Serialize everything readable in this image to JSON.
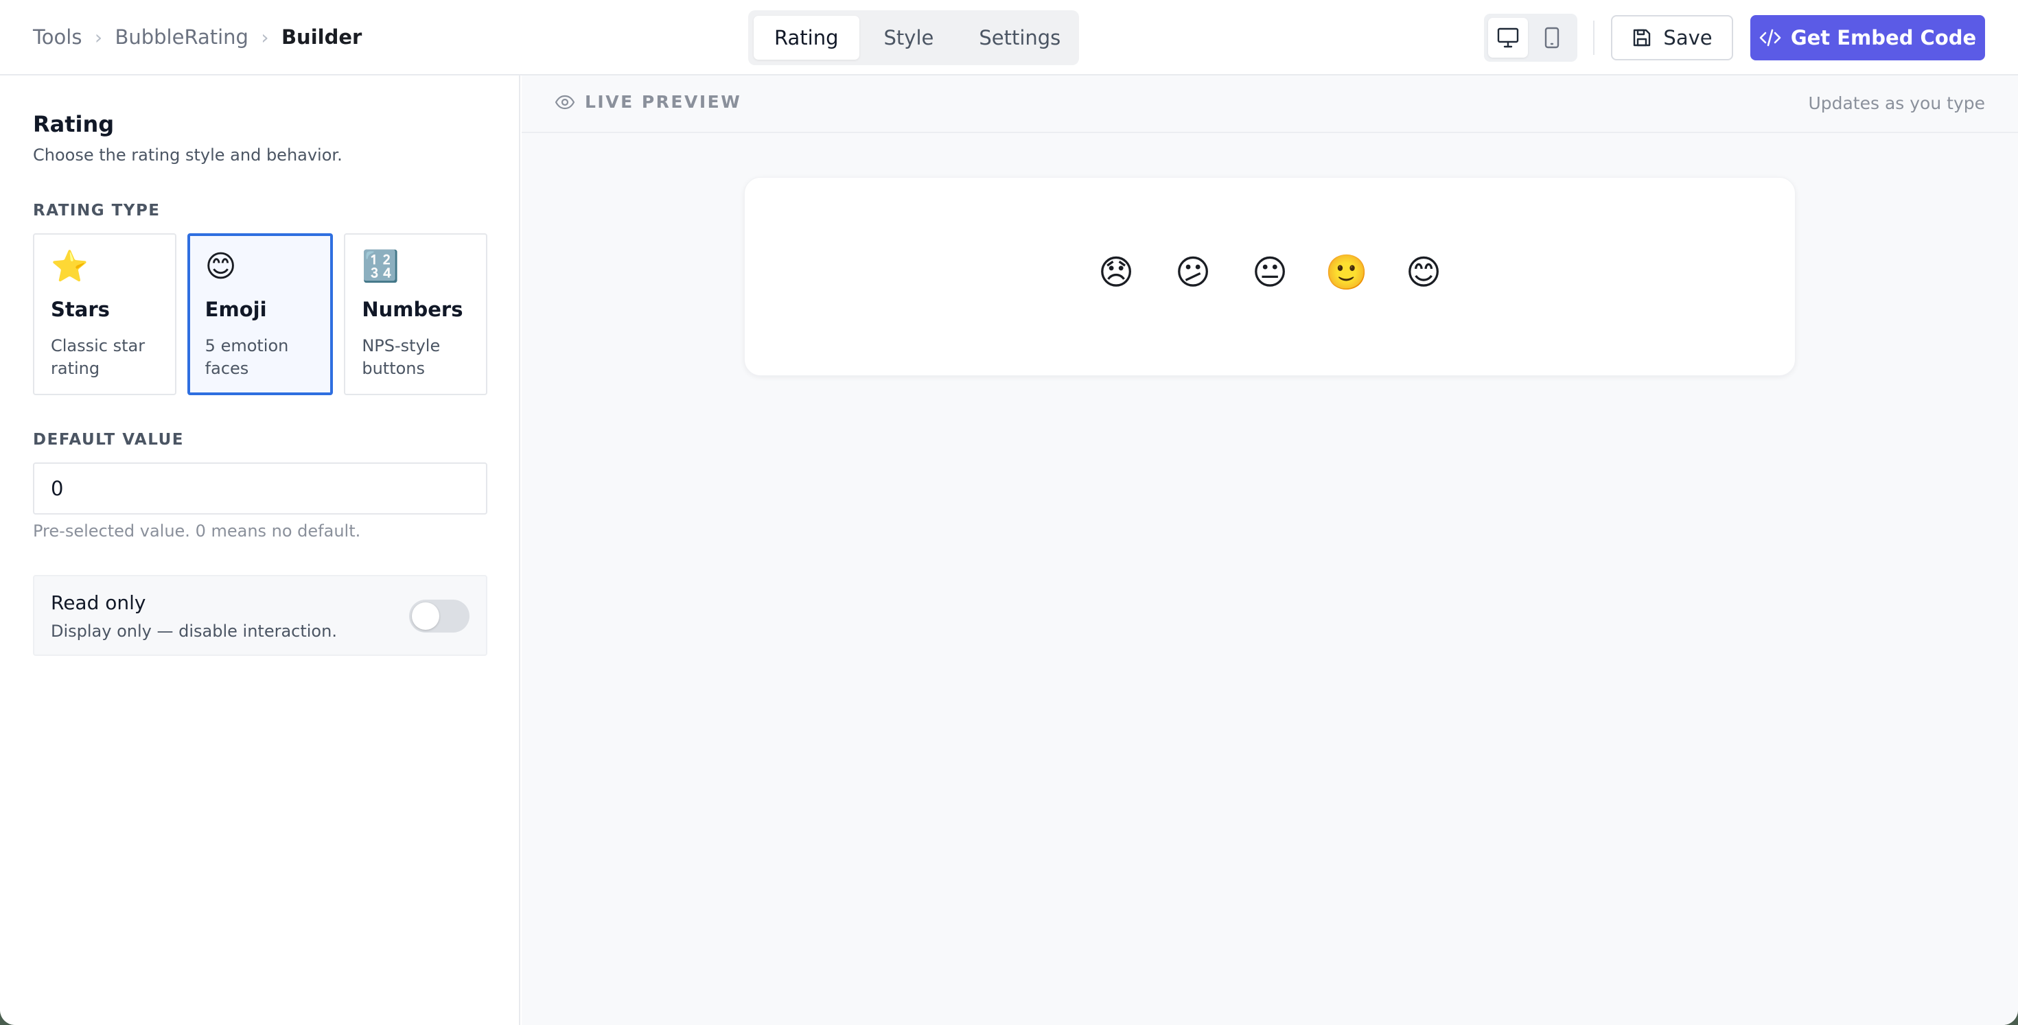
{
  "breadcrumb": {
    "items": [
      "Tools",
      "BubbleRating",
      "Builder"
    ],
    "separator": "›"
  },
  "tabs": [
    {
      "label": "Rating",
      "active": true
    },
    {
      "label": "Style",
      "active": false
    },
    {
      "label": "Settings",
      "active": false
    }
  ],
  "device_toggle": {
    "options": [
      "desktop-icon",
      "mobile-icon"
    ],
    "active": "desktop-icon"
  },
  "toolbar": {
    "save_label": "Save",
    "embed_label": "Get Embed Code",
    "accent_color": "#5b5be6"
  },
  "sidebar": {
    "title": "Rating",
    "subtitle": "Choose the rating style and behavior.",
    "rating_type_label": "RATING TYPE",
    "rating_types": [
      {
        "icon": "⭐",
        "title": "Stars",
        "desc": "Classic star rating",
        "selected": false
      },
      {
        "icon": "😊",
        "title": "Emoji",
        "desc": "5 emotion faces",
        "selected": true
      },
      {
        "icon": "🔢",
        "title": "Numbers",
        "desc": "NPS-style buttons",
        "selected": false
      }
    ],
    "default_value_label": "DEFAULT VALUE",
    "default_value": "0",
    "default_value_help": "Pre-selected value. 0 means no default.",
    "read_only": {
      "title": "Read only",
      "desc": "Display only — disable interaction.",
      "enabled": false
    },
    "selected_color": "#2f6fe0"
  },
  "preview": {
    "label": "LIVE PREVIEW",
    "hint": "Updates as you type",
    "emojis": [
      "😞",
      "😕",
      "😐",
      "🙂",
      "😊"
    ]
  }
}
